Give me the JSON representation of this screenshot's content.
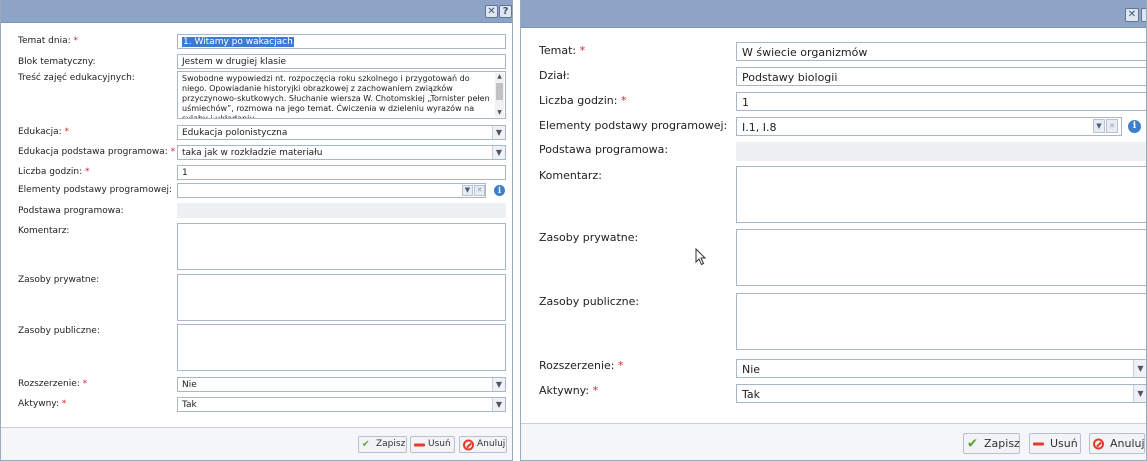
{
  "req_mark": "*",
  "close_glyph": "✕",
  "help_glyph": "?",
  "info_glyph": "i",
  "select_arrow": "⌵",
  "clear_glyph": "✕",
  "a": {
    "temat_label": "Temat dnia:",
    "temat_value": "1. Witamy po wakacjach",
    "blok_label": "Blok tematyczny:",
    "blok_value": "Jestem w drugiej klasie",
    "tresc_label": "Treść zajęć edukacyjnych:",
    "tresc_value": "Swobodne wypowiedzi nt. rozpoczęcia roku szkolnego i przygotowań do niego. Opowiadanie historyjki obrazkowej z zachowaniem związków przyczynowo-skutkowych. Słuchanie wiersza W. Chotomskiej „Tornister pełen uśmiechów”, rozmowa na jego temat. Ćwiczenia w dzieleniu wyrazów na sylaby i układaniu",
    "edukacja_label": "Edukacja:",
    "edukacja_value": "Edukacja polonistyczna",
    "edu_pp_label": "Edukacja podstawa programowa:",
    "edu_pp_value": "taka jak w rozkładzie materiału",
    "liczba_label": "Liczba godzin:",
    "liczba_value": "1",
    "elementy_label": "Elementy podstawy programowej:",
    "elementy_value": "",
    "podstawa_label": "Podstawa programowa:",
    "komentarz_label": "Komentarz:",
    "prywatne_label": "Zasoby prywatne:",
    "publiczne_label": "Zasoby publiczne:",
    "rozszerzenie_label": "Rozszerzenie:",
    "rozszerzenie_value": "Nie",
    "aktywny_label": "Aktywny:",
    "aktywny_value": "Tak",
    "save": "Zapisz",
    "delete": "Usuń",
    "cancel": "Anuluj"
  },
  "b": {
    "temat_label": "Temat:",
    "temat_value": "W świecie organizmów",
    "dzial_label": "Dział:",
    "dzial_value": "Podstawy biologii",
    "liczba_label": "Liczba godzin:",
    "liczba_value": "1",
    "elementy_label": "Elementy podstawy programowej:",
    "elementy_value": "I.1, I.8",
    "podstawa_label": "Podstawa programowa:",
    "komentarz_label": "Komentarz:",
    "prywatne_label": "Zasoby prywatne:",
    "publiczne_label": "Zasoby publiczne:",
    "rozszerzenie_label": "Rozszerzenie:",
    "rozszerzenie_value": "Nie",
    "aktywny_label": "Aktywny:",
    "aktywny_value": "Tak",
    "save": "Zapisz",
    "delete": "Usuń",
    "cancel": "Anuluj"
  }
}
